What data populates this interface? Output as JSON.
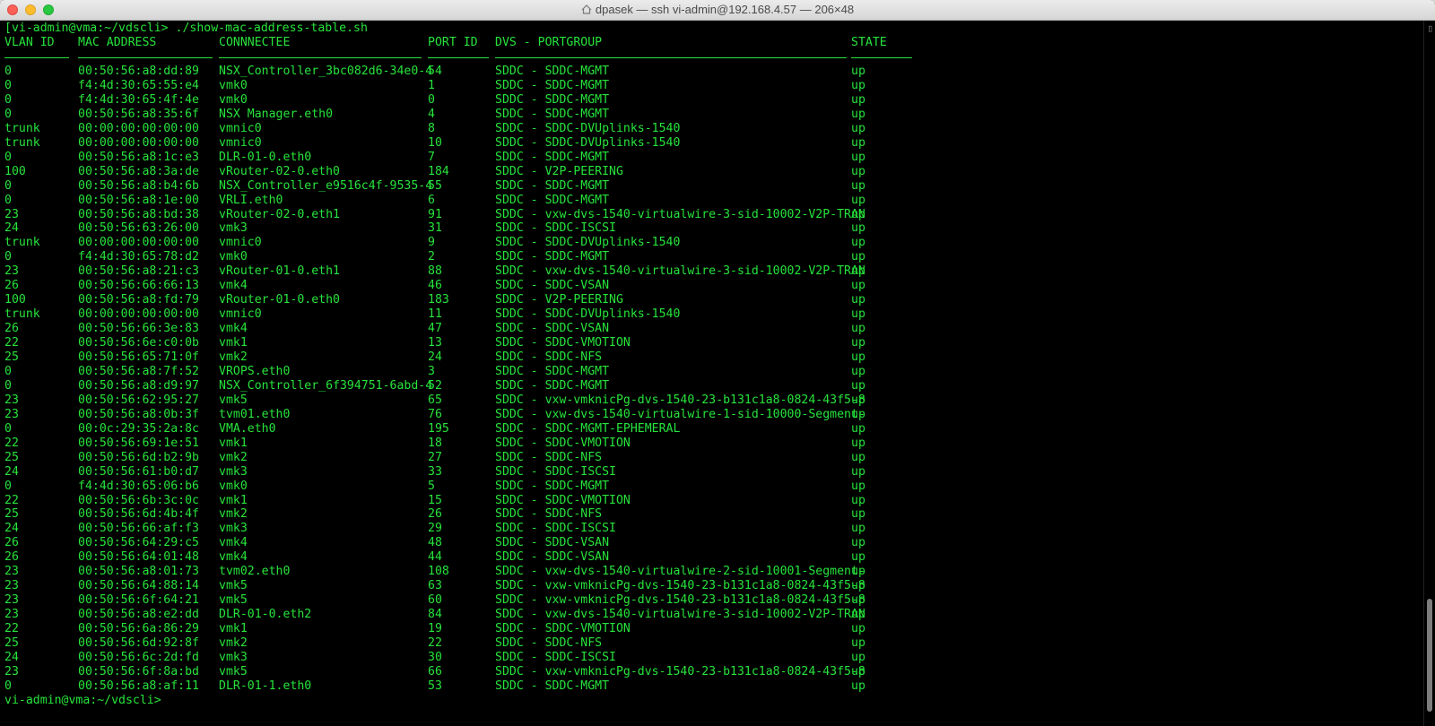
{
  "window": {
    "title": "dpasek — ssh vi-admin@192.168.4.57 — 206×48"
  },
  "terminal": {
    "command_line": "[vi-admin@vma:~/vdscli> ./show-mac-address-table.sh",
    "prompt_end": "vi-admin@vma:~/vdscli>",
    "headers": [
      "VLAN ID",
      "MAC ADDRESS",
      "CONNNECTEE",
      "PORT ID",
      "DVS - PORTGROUP",
      "STATE"
    ],
    "rows": [
      [
        "0",
        "00:50:56:a8:dd:89",
        "NSX_Controller_3bc082d6-34e0-4",
        "54",
        "SDDC - SDDC-MGMT",
        "up"
      ],
      [
        "0",
        "f4:4d:30:65:55:e4",
        "vmk0",
        "1",
        "SDDC - SDDC-MGMT",
        "up"
      ],
      [
        "0",
        "f4:4d:30:65:4f:4e",
        "vmk0",
        "0",
        "SDDC - SDDC-MGMT",
        "up"
      ],
      [
        "0",
        "00:50:56:a8:35:6f",
        "NSX Manager.eth0",
        "4",
        "SDDC - SDDC-MGMT",
        "up"
      ],
      [
        "trunk",
        "00:00:00:00:00:00",
        "vmnic0",
        "8",
        "SDDC - SDDC-DVUplinks-1540",
        "up"
      ],
      [
        "trunk",
        "00:00:00:00:00:00",
        "vmnic0",
        "10",
        "SDDC - SDDC-DVUplinks-1540",
        "up"
      ],
      [
        "0",
        "00:50:56:a8:1c:e3",
        "DLR-01-0.eth0",
        "7",
        "SDDC - SDDC-MGMT",
        "up"
      ],
      [
        "100",
        "00:50:56:a8:3a:de",
        "vRouter-02-0.eth0",
        "184",
        "SDDC - V2P-PEERING",
        "up"
      ],
      [
        "0",
        "00:50:56:a8:b4:6b",
        "NSX_Controller_e9516c4f-9535-4",
        "55",
        "SDDC - SDDC-MGMT",
        "up"
      ],
      [
        "0",
        "00:50:56:a8:1e:00",
        "VRLI.eth0",
        "6",
        "SDDC - SDDC-MGMT",
        "up"
      ],
      [
        "23",
        "00:50:56:a8:bd:38",
        "vRouter-02-0.eth1",
        "91",
        "SDDC - vxw-dvs-1540-virtualwire-3-sid-10002-V2P-TRAN",
        "up"
      ],
      [
        "24",
        "00:50:56:63:26:00",
        "vmk3",
        "31",
        "SDDC - SDDC-ISCSI",
        "up"
      ],
      [
        "trunk",
        "00:00:00:00:00:00",
        "vmnic0",
        "9",
        "SDDC - SDDC-DVUplinks-1540",
        "up"
      ],
      [
        "0",
        "f4:4d:30:65:78:d2",
        "vmk0",
        "2",
        "SDDC - SDDC-MGMT",
        "up"
      ],
      [
        "23",
        "00:50:56:a8:21:c3",
        "vRouter-01-0.eth1",
        "88",
        "SDDC - vxw-dvs-1540-virtualwire-3-sid-10002-V2P-TRAN",
        "up"
      ],
      [
        "26",
        "00:50:56:66:66:13",
        "vmk4",
        "46",
        "SDDC - SDDC-VSAN",
        "up"
      ],
      [
        "100",
        "00:50:56:a8:fd:79",
        "vRouter-01-0.eth0",
        "183",
        "SDDC - V2P-PEERING",
        "up"
      ],
      [
        "trunk",
        "00:00:00:00:00:00",
        "vmnic0",
        "11",
        "SDDC - SDDC-DVUplinks-1540",
        "up"
      ],
      [
        "26",
        "00:50:56:66:3e:83",
        "vmk4",
        "47",
        "SDDC - SDDC-VSAN",
        "up"
      ],
      [
        "22",
        "00:50:56:6e:c0:0b",
        "vmk1",
        "13",
        "SDDC - SDDC-VMOTION",
        "up"
      ],
      [
        "25",
        "00:50:56:65:71:0f",
        "vmk2",
        "24",
        "SDDC - SDDC-NFS",
        "up"
      ],
      [
        "0",
        "00:50:56:a8:7f:52",
        "VROPS.eth0",
        "3",
        "SDDC - SDDC-MGMT",
        "up"
      ],
      [
        "0",
        "00:50:56:a8:d9:97",
        "NSX_Controller_6f394751-6abd-4",
        "52",
        "SDDC - SDDC-MGMT",
        "up"
      ],
      [
        "23",
        "00:50:56:62:95:27",
        "vmk5",
        "65",
        "SDDC - vxw-vmknicPg-dvs-1540-23-b131c1a8-0824-43f5-8",
        "up"
      ],
      [
        "23",
        "00:50:56:a8:0b:3f",
        "tvm01.eth0",
        "76",
        "SDDC - vxw-dvs-1540-virtualwire-1-sid-10000-Segment-",
        "up"
      ],
      [
        "0",
        "00:0c:29:35:2a:8c",
        "VMA.eth0",
        "195",
        "SDDC - SDDC-MGMT-EPHEMERAL",
        "up"
      ],
      [
        "22",
        "00:50:56:69:1e:51",
        "vmk1",
        "18",
        "SDDC - SDDC-VMOTION",
        "up"
      ],
      [
        "25",
        "00:50:56:6d:b2:9b",
        "vmk2",
        "27",
        "SDDC - SDDC-NFS",
        "up"
      ],
      [
        "24",
        "00:50:56:61:b0:d7",
        "vmk3",
        "33",
        "SDDC - SDDC-ISCSI",
        "up"
      ],
      [
        "0",
        "f4:4d:30:65:06:b6",
        "vmk0",
        "5",
        "SDDC - SDDC-MGMT",
        "up"
      ],
      [
        "22",
        "00:50:56:6b:3c:0c",
        "vmk1",
        "15",
        "SDDC - SDDC-VMOTION",
        "up"
      ],
      [
        "25",
        "00:50:56:6d:4b:4f",
        "vmk2",
        "26",
        "SDDC - SDDC-NFS",
        "up"
      ],
      [
        "24",
        "00:50:56:66:af:f3",
        "vmk3",
        "29",
        "SDDC - SDDC-ISCSI",
        "up"
      ],
      [
        "26",
        "00:50:56:64:29:c5",
        "vmk4",
        "48",
        "SDDC - SDDC-VSAN",
        "up"
      ],
      [
        "26",
        "00:50:56:64:01:48",
        "vmk4",
        "44",
        "SDDC - SDDC-VSAN",
        "up"
      ],
      [
        "23",
        "00:50:56:a8:01:73",
        "tvm02.eth0",
        "108",
        "SDDC - vxw-dvs-1540-virtualwire-2-sid-10001-Segment-",
        "up"
      ],
      [
        "23",
        "00:50:56:64:88:14",
        "vmk5",
        "63",
        "SDDC - vxw-vmknicPg-dvs-1540-23-b131c1a8-0824-43f5-8",
        "up"
      ],
      [
        "23",
        "00:50:56:6f:64:21",
        "vmk5",
        "60",
        "SDDC - vxw-vmknicPg-dvs-1540-23-b131c1a8-0824-43f5-8",
        "up"
      ],
      [
        "23",
        "00:50:56:a8:e2:dd",
        "DLR-01-0.eth2",
        "84",
        "SDDC - vxw-dvs-1540-virtualwire-3-sid-10002-V2P-TRAN",
        "up"
      ],
      [
        "22",
        "00:50:56:6a:86:29",
        "vmk1",
        "19",
        "SDDC - SDDC-VMOTION",
        "up"
      ],
      [
        "25",
        "00:50:56:6d:92:8f",
        "vmk2",
        "22",
        "SDDC - SDDC-NFS",
        "up"
      ],
      [
        "24",
        "00:50:56:6c:2d:fd",
        "vmk3",
        "30",
        "SDDC - SDDC-ISCSI",
        "up"
      ],
      [
        "23",
        "00:50:56:6f:8a:bd",
        "vmk5",
        "66",
        "SDDC - vxw-vmknicPg-dvs-1540-23-b131c1a8-0824-43f5-8",
        "up"
      ],
      [
        "0",
        "00:50:56:a8:af:11",
        "DLR-01-1.eth0",
        "53",
        "SDDC - SDDC-MGMT",
        "up"
      ]
    ]
  },
  "colors": {
    "terminal_fg": "#27e33c",
    "terminal_bg": "#000000"
  },
  "scroll": {
    "position_fraction": 0.82,
    "visible_fraction": 0.16
  }
}
